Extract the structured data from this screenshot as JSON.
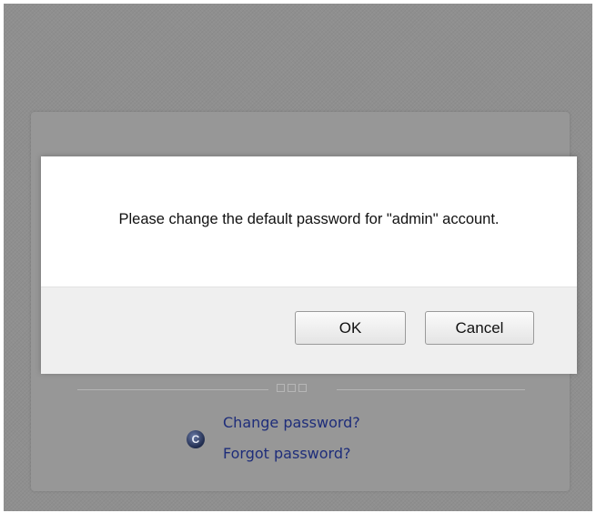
{
  "dialog": {
    "message": "Please change the default password for \"admin\" account.",
    "ok_label": "OK",
    "cancel_label": "Cancel"
  },
  "login_panel": {
    "change_password_link": "Change password?",
    "forgot_password_link": "Forgot password?",
    "help_icon": "help-c-icon",
    "help_icon_glyph": "C"
  }
}
